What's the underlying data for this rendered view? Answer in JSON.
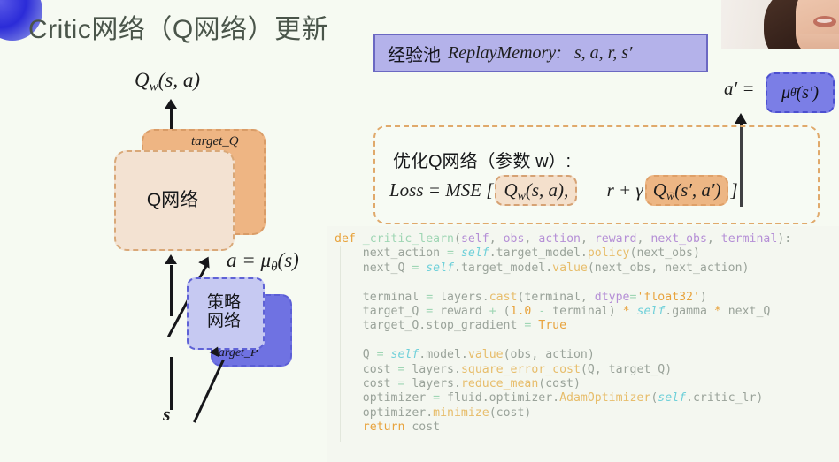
{
  "slide": {
    "title": "Critic网络（Q网络）更新",
    "background_color": "#f6faf2",
    "title_color": "#4a554a"
  },
  "replay": {
    "cn_label": "经验池",
    "en_label": "ReplayMemory",
    "colon": ":",
    "tuple": "s, a, r, s′"
  },
  "diagram": {
    "q_value_label": "Q",
    "q_value_sub": "w",
    "q_value_args": "(s, a)",
    "target_q_label": "target_Q",
    "q_net_label": "Q网络",
    "policy_label_line1": "策略",
    "policy_label_line2": "网络",
    "target_p_label": "target_P",
    "action_eq_a": "a",
    "action_eq_sign": "=",
    "action_eq_mu": "μ",
    "action_eq_sub": "θ",
    "action_eq_args": "(s)",
    "state_label": "s"
  },
  "aprime": {
    "lhs": "a′",
    "eq": "=",
    "mu": "μ",
    "mu_sub": "θ̄",
    "args": "(s′)"
  },
  "optimize": {
    "title": "优化Q网络（参数 w）:",
    "loss_word": "Loss",
    "eq": "=",
    "mse": "MSE",
    "bracket_open": "[",
    "term1_q": "Q",
    "term1_sub": "w",
    "term1_args": "(s, a)",
    "comma": ",",
    "term2_r": "r",
    "term2_plus": "+",
    "term2_gamma": "γ",
    "term2_q": "Q",
    "term2_sub": "w̄",
    "term2_args": "(s′, a′)",
    "bracket_close": "]"
  },
  "code": {
    "language": "python",
    "lines": [
      [
        {
          "t": "def ",
          "c": "c-kw"
        },
        {
          "t": "_critic_learn",
          "c": "c-fn"
        },
        {
          "t": "(",
          "c": "c-plain"
        },
        {
          "t": "self",
          "c": "c-par"
        },
        {
          "t": ", ",
          "c": "c-plain"
        },
        {
          "t": "obs",
          "c": "c-par"
        },
        {
          "t": ", ",
          "c": "c-plain"
        },
        {
          "t": "action",
          "c": "c-par"
        },
        {
          "t": ", ",
          "c": "c-plain"
        },
        {
          "t": "reward",
          "c": "c-par"
        },
        {
          "t": ", ",
          "c": "c-plain"
        },
        {
          "t": "next_obs",
          "c": "c-par"
        },
        {
          "t": ", ",
          "c": "c-plain"
        },
        {
          "t": "terminal",
          "c": "c-par"
        },
        {
          "t": "):",
          "c": "c-plain"
        }
      ],
      [
        {
          "t": "    next_action ",
          "c": "c-plain"
        },
        {
          "t": "= ",
          "c": "c-op"
        },
        {
          "t": "self",
          "c": "c-self"
        },
        {
          "t": ".target_model.",
          "c": "c-plain"
        },
        {
          "t": "policy",
          "c": "c-meth"
        },
        {
          "t": "(next_obs)",
          "c": "c-plain"
        }
      ],
      [
        {
          "t": "    next_Q ",
          "c": "c-plain"
        },
        {
          "t": "= ",
          "c": "c-op"
        },
        {
          "t": "self",
          "c": "c-self"
        },
        {
          "t": ".target_model.",
          "c": "c-plain"
        },
        {
          "t": "value",
          "c": "c-meth"
        },
        {
          "t": "(next_obs, next_action)",
          "c": "c-plain"
        }
      ],
      [],
      [
        {
          "t": "    terminal ",
          "c": "c-plain"
        },
        {
          "t": "= ",
          "c": "c-op"
        },
        {
          "t": "layers.",
          "c": "c-plain"
        },
        {
          "t": "cast",
          "c": "c-meth"
        },
        {
          "t": "(terminal, ",
          "c": "c-plain"
        },
        {
          "t": "dtype",
          "c": "c-par"
        },
        {
          "t": "=",
          "c": "c-op"
        },
        {
          "t": "'float32'",
          "c": "c-str"
        },
        {
          "t": ")",
          "c": "c-plain"
        }
      ],
      [
        {
          "t": "    target_Q ",
          "c": "c-plain"
        },
        {
          "t": "= ",
          "c": "c-op"
        },
        {
          "t": "reward ",
          "c": "c-plain"
        },
        {
          "t": "+ ",
          "c": "c-op"
        },
        {
          "t": "(",
          "c": "c-plain"
        },
        {
          "t": "1.0",
          "c": "c-num"
        },
        {
          "t": " ",
          "c": "c-plain"
        },
        {
          "t": "-",
          "c": "c-op"
        },
        {
          "t": " terminal) ",
          "c": "c-plain"
        },
        {
          "t": "* ",
          "c": "c-num"
        },
        {
          "t": "self",
          "c": "c-self"
        },
        {
          "t": ".gamma ",
          "c": "c-plain"
        },
        {
          "t": "* ",
          "c": "c-num"
        },
        {
          "t": "next_Q",
          "c": "c-plain"
        }
      ],
      [
        {
          "t": "    target_Q.stop_gradient ",
          "c": "c-plain"
        },
        {
          "t": "= ",
          "c": "c-op"
        },
        {
          "t": "True",
          "c": "c-bool"
        }
      ],
      [],
      [
        {
          "t": "    Q ",
          "c": "c-plain"
        },
        {
          "t": "= ",
          "c": "c-op"
        },
        {
          "t": "self",
          "c": "c-self"
        },
        {
          "t": ".model.",
          "c": "c-plain"
        },
        {
          "t": "value",
          "c": "c-meth"
        },
        {
          "t": "(obs, action)",
          "c": "c-plain"
        }
      ],
      [
        {
          "t": "    cost ",
          "c": "c-plain"
        },
        {
          "t": "= ",
          "c": "c-op"
        },
        {
          "t": "layers.",
          "c": "c-plain"
        },
        {
          "t": "square_error_cost",
          "c": "c-meth"
        },
        {
          "t": "(Q, target_Q)",
          "c": "c-plain"
        }
      ],
      [
        {
          "t": "    cost ",
          "c": "c-plain"
        },
        {
          "t": "= ",
          "c": "c-op"
        },
        {
          "t": "layers.",
          "c": "c-plain"
        },
        {
          "t": "reduce_mean",
          "c": "c-meth"
        },
        {
          "t": "(cost)",
          "c": "c-plain"
        }
      ],
      [
        {
          "t": "    optimizer ",
          "c": "c-plain"
        },
        {
          "t": "= ",
          "c": "c-op"
        },
        {
          "t": "fluid.optimizer.",
          "c": "c-plain"
        },
        {
          "t": "AdamOptimizer",
          "c": "c-meth"
        },
        {
          "t": "(",
          "c": "c-plain"
        },
        {
          "t": "self",
          "c": "c-self"
        },
        {
          "t": ".critic_lr)",
          "c": "c-plain"
        }
      ],
      [
        {
          "t": "    optimizer.",
          "c": "c-plain"
        },
        {
          "t": "minimize",
          "c": "c-meth"
        },
        {
          "t": "(cost)",
          "c": "c-plain"
        }
      ],
      [
        {
          "t": "    ",
          "c": "c-plain"
        },
        {
          "t": "return",
          "c": "c-kw"
        },
        {
          "t": " cost",
          "c": "c-plain"
        }
      ]
    ]
  },
  "colors": {
    "accent_orange": "#eeb583",
    "accent_orange_light": "#f3e2d2",
    "accent_purple": "#b4b2ea",
    "accent_purple_deep": "#6f72e2",
    "dashed_orange": "#e0a96b",
    "code_bg": "#f4f7f0"
  }
}
